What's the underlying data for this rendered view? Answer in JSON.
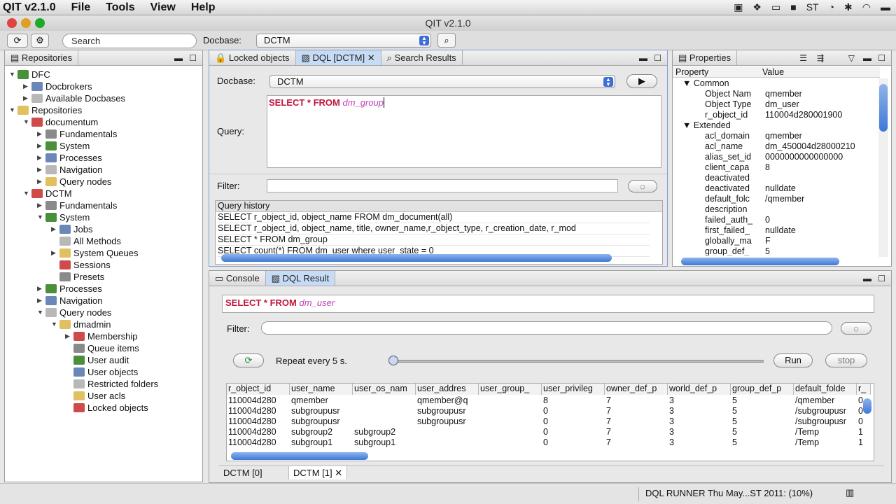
{
  "menubar": {
    "app": "QIT v2.1.0",
    "items": [
      "File",
      "Tools",
      "View",
      "Help"
    ]
  },
  "window": {
    "title": "QIT v2.1.0"
  },
  "toolbar": {
    "search_placeholder": "Search",
    "docbase_label": "Docbase:",
    "docbase_value": "DCTM"
  },
  "repositories": {
    "tab": "Repositories",
    "nodes": [
      {
        "label": "DFC",
        "depth": 0,
        "tw": "▼"
      },
      {
        "label": "Docbrokers",
        "depth": 1,
        "tw": "▶"
      },
      {
        "label": "Available Docbases",
        "depth": 1,
        "tw": "▶"
      },
      {
        "label": "Repositories",
        "depth": 0,
        "tw": "▼"
      },
      {
        "label": "documentum",
        "depth": 1,
        "tw": "▼"
      },
      {
        "label": "Fundamentals",
        "depth": 2,
        "tw": "▶"
      },
      {
        "label": "System",
        "depth": 2,
        "tw": "▶"
      },
      {
        "label": "Processes",
        "depth": 2,
        "tw": "▶"
      },
      {
        "label": "Navigation",
        "depth": 2,
        "tw": "▶"
      },
      {
        "label": "Query nodes",
        "depth": 2,
        "tw": "▶"
      },
      {
        "label": "DCTM",
        "depth": 1,
        "tw": "▼"
      },
      {
        "label": "Fundamentals",
        "depth": 2,
        "tw": "▶"
      },
      {
        "label": "System",
        "depth": 2,
        "tw": "▼"
      },
      {
        "label": "Jobs",
        "depth": 3,
        "tw": "▶"
      },
      {
        "label": "All Methods",
        "depth": 3,
        "tw": ""
      },
      {
        "label": "System Queues",
        "depth": 3,
        "tw": "▶"
      },
      {
        "label": "Sessions",
        "depth": 3,
        "tw": ""
      },
      {
        "label": "Presets",
        "depth": 3,
        "tw": ""
      },
      {
        "label": "Processes",
        "depth": 2,
        "tw": "▶"
      },
      {
        "label": "Navigation",
        "depth": 2,
        "tw": "▶"
      },
      {
        "label": "Query nodes",
        "depth": 2,
        "tw": "▼"
      },
      {
        "label": "dmadmin",
        "depth": 3,
        "tw": "▼"
      },
      {
        "label": "Membership",
        "depth": 4,
        "tw": "▶"
      },
      {
        "label": "Queue items",
        "depth": 4,
        "tw": ""
      },
      {
        "label": "User audit",
        "depth": 4,
        "tw": ""
      },
      {
        "label": "User objects",
        "depth": 4,
        "tw": ""
      },
      {
        "label": "Restricted folders",
        "depth": 4,
        "tw": ""
      },
      {
        "label": "User acls",
        "depth": 4,
        "tw": ""
      },
      {
        "label": "Locked objects",
        "depth": 4,
        "tw": ""
      }
    ]
  },
  "center": {
    "tabs": [
      "Locked objects",
      "DQL [DCTM]",
      "Search Results"
    ],
    "docbase_label": "Docbase:",
    "docbase_value": "DCTM",
    "query_label": "Query:",
    "query_kw": "SELECT * FROM",
    "query_table": "dm_group",
    "filter_label": "Filter:",
    "history_label": "Query history",
    "history": [
      "SELECT r_object_id, object_name FROM dm_document(all)",
      "SELECT r_object_id, object_name, title, owner_name,r_object_type, r_creation_date, r_mod",
      "SELECT * FROM dm_group",
      "SELECT count(*) FROM dm_user where user_state = 0"
    ]
  },
  "properties": {
    "tab": "Properties",
    "col_property": "Property",
    "col_value": "Value",
    "rows": [
      {
        "k": "▼ Common",
        "v": "",
        "group": true
      },
      {
        "k": "Object Nam",
        "v": "qmember"
      },
      {
        "k": "Object Type",
        "v": "dm_user"
      },
      {
        "k": "r_object_id",
        "v": "110004d280001900"
      },
      {
        "k": "▼ Extended",
        "v": "",
        "group": true
      },
      {
        "k": "acl_domain",
        "v": "qmember"
      },
      {
        "k": "acl_name",
        "v": "dm_450004d28000210"
      },
      {
        "k": "alias_set_id",
        "v": "0000000000000000"
      },
      {
        "k": "client_capa",
        "v": "8"
      },
      {
        "k": "deactivated",
        "v": ""
      },
      {
        "k": "deactivated",
        "v": "nulldate"
      },
      {
        "k": "default_folc",
        "v": "/qmember"
      },
      {
        "k": "description",
        "v": ""
      },
      {
        "k": "failed_auth_",
        "v": "0"
      },
      {
        "k": "first_failed_",
        "v": "nulldate"
      },
      {
        "k": "globally_ma",
        "v": "F"
      },
      {
        "k": "group_def_",
        "v": "5"
      }
    ]
  },
  "bottom": {
    "tabs": [
      "Console",
      "DQL Result"
    ],
    "query_kw": "SELECT * FROM",
    "query_table": "dm_user",
    "filter_label": "Filter:",
    "repeat_label": "Repeat every 5 s.",
    "run": "Run",
    "stop": "stop",
    "columns": [
      "r_object_id",
      "user_name",
      "user_os_nam",
      "user_addres",
      "user_group_",
      "user_privileg",
      "owner_def_p",
      "world_def_p",
      "group_def_p",
      "default_folde",
      "r_"
    ],
    "rows": [
      [
        "110004d280",
        "qmember",
        "",
        "qmember@q",
        "",
        "8",
        "7",
        "3",
        "5",
        "/qmember",
        "0"
      ],
      [
        "110004d280",
        "subgroupusr",
        "",
        "subgroupusr",
        "",
        "0",
        "7",
        "3",
        "5",
        "/subgroupusr",
        "0"
      ],
      [
        "110004d280",
        "subgroupusr",
        "",
        "subgroupusr",
        "",
        "0",
        "7",
        "3",
        "5",
        "/subgroupusr",
        "0"
      ],
      [
        "110004d280",
        "subgroup2",
        "subgroup2",
        "",
        "",
        "0",
        "7",
        "3",
        "5",
        "/Temp",
        "1"
      ],
      [
        "110004d280",
        "subgroup1",
        "subgroup1",
        "",
        "",
        "0",
        "7",
        "3",
        "5",
        "/Temp",
        "1"
      ]
    ],
    "result_tabs": [
      "DCTM [0]",
      "DCTM [1]"
    ]
  },
  "status": {
    "text": "DQL RUNNER Thu May...ST 2011: (10%)"
  }
}
